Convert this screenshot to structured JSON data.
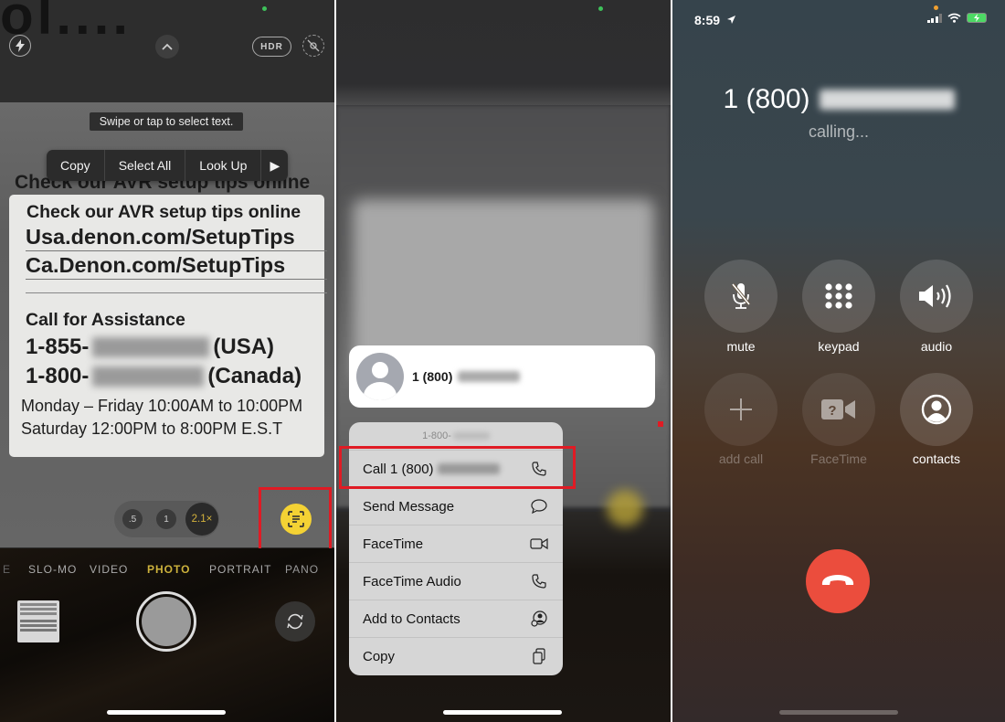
{
  "camera": {
    "partial_bg_text": "ol....",
    "hdr_label": "HDR",
    "hint": "Swipe or tap to select text.",
    "edit_menu": [
      "Copy",
      "Select All",
      "Look Up",
      "▶"
    ],
    "bg_line": "Check our AVR setup tips online",
    "card": {
      "line1": "Check our AVR setup tips online",
      "url1": "Usa.denon.com/SetupTips",
      "url2": "Ca.Denon.com/SetupTips",
      "heading": "Call for Assistance",
      "phone_usa_prefix": "1-855-",
      "phone_usa_suffix": "(USA)",
      "phone_ca_prefix": "1-800-",
      "phone_ca_suffix": "(Canada)",
      "hours1": "Monday – Friday 10:00AM to 10:00PM",
      "hours2": "Saturday 12:00PM to 8:00PM E.S.T"
    },
    "zoom_levels": [
      ".5",
      "1",
      "2.1×"
    ],
    "selected_zoom": "2.1×",
    "modes": [
      "E",
      "SLO-MO",
      "VIDEO",
      "PHOTO",
      "PORTRAIT",
      "PANO"
    ],
    "active_mode": "PHOTO",
    "accent_color": "#f4d234",
    "highlight_color": "#e01b24"
  },
  "context_menu": {
    "contact_number_prefix": "1 (800)",
    "header_number_prefix": "1-800-",
    "items": [
      {
        "label": "Call 1 (800)",
        "icon": "phone-icon"
      },
      {
        "label": "Send Message",
        "icon": "message-icon"
      },
      {
        "label": "FaceTime",
        "icon": "video-camera-icon"
      },
      {
        "label": "FaceTime Audio",
        "icon": "phone-icon"
      },
      {
        "label": "Add to Contacts",
        "icon": "add-contact-icon"
      },
      {
        "label": "Copy",
        "icon": "copy-icon"
      }
    ]
  },
  "call_screen": {
    "time": "8:59",
    "caller_prefix": "1 (800)",
    "status": "calling...",
    "buttons": [
      {
        "label": "mute",
        "icon": "mic-slash-icon",
        "enabled": true
      },
      {
        "label": "keypad",
        "icon": "keypad-icon",
        "enabled": true
      },
      {
        "label": "audio",
        "icon": "speaker-icon",
        "enabled": true
      },
      {
        "label": "add call",
        "icon": "plus-icon",
        "enabled": false
      },
      {
        "label": "FaceTime",
        "icon": "facetime-icon",
        "enabled": false
      },
      {
        "label": "contacts",
        "icon": "contacts-icon",
        "enabled": true
      }
    ],
    "end_call_color": "#eb4d3d"
  }
}
